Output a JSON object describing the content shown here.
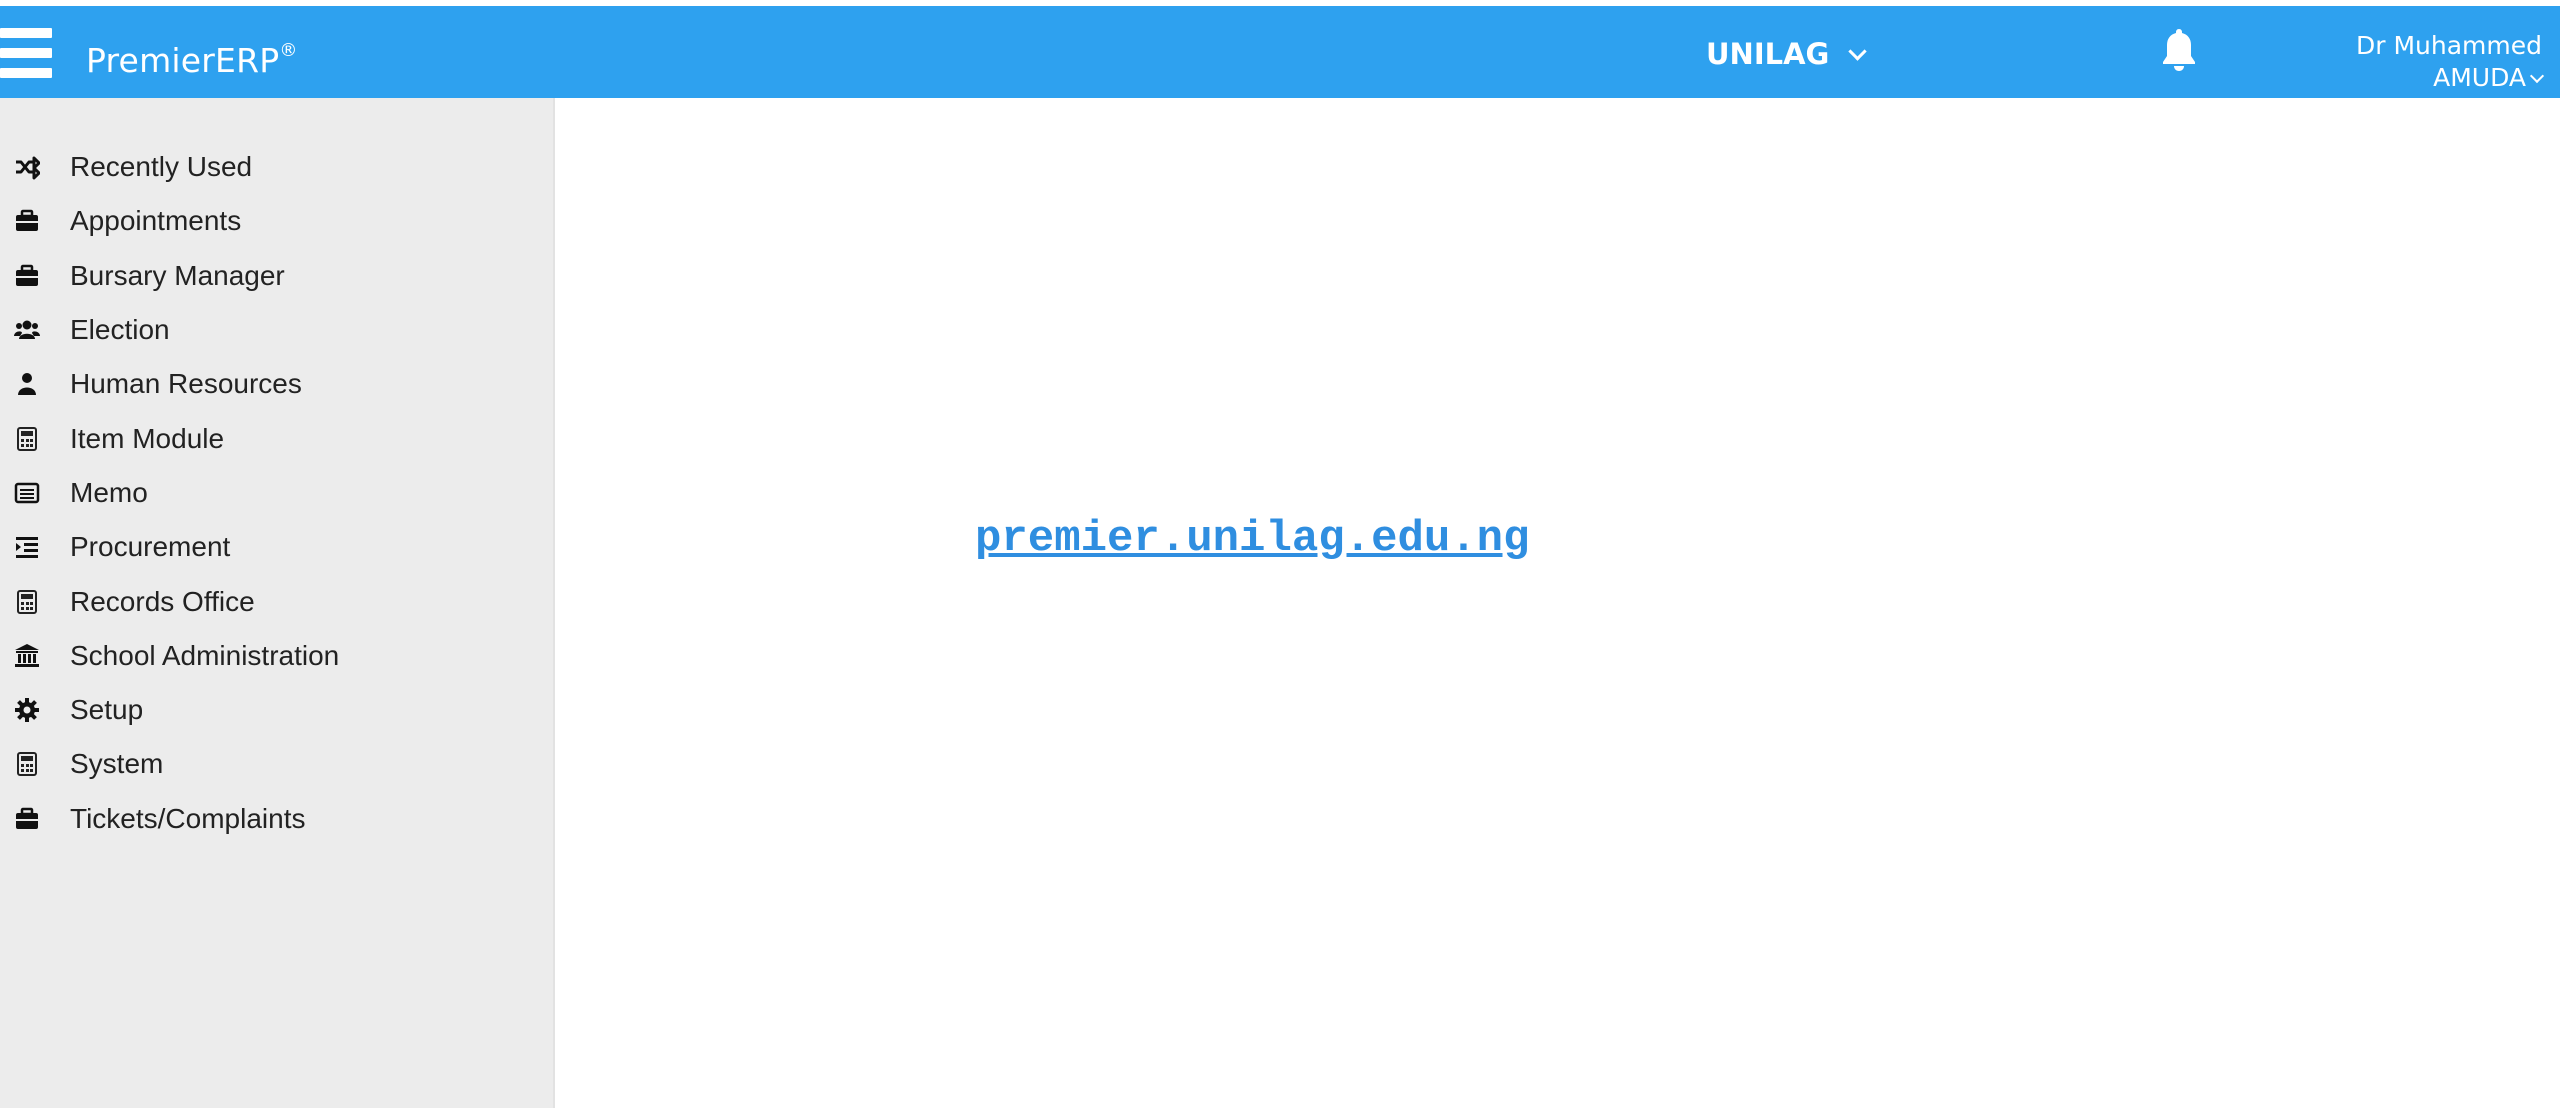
{
  "brand": {
    "name": "PremierERP",
    "mark": "®"
  },
  "header": {
    "organization": "UNILAG",
    "user_line1": "Dr Muhammed",
    "user_line2": "AMUDA"
  },
  "colors": {
    "navbar": "#2ea1ef",
    "sidebar": "#ececec",
    "link": "#2f8ee0"
  },
  "sidebar": {
    "items": [
      {
        "label": "Recently Used",
        "icon": "shuffle-icon"
      },
      {
        "label": "Appointments",
        "icon": "briefcase-icon"
      },
      {
        "label": "Bursary Manager",
        "icon": "briefcase-icon"
      },
      {
        "label": "Election",
        "icon": "users-icon"
      },
      {
        "label": "Human Resources",
        "icon": "user-icon"
      },
      {
        "label": "Item Module",
        "icon": "calculator-icon"
      },
      {
        "label": "Memo",
        "icon": "list-alt-icon"
      },
      {
        "label": "Procurement",
        "icon": "indent-icon"
      },
      {
        "label": "Records Office",
        "icon": "calculator-icon"
      },
      {
        "label": "School Administration",
        "icon": "bank-icon"
      },
      {
        "label": "Setup",
        "icon": "gear-icon"
      },
      {
        "label": "System",
        "icon": "calculator-icon"
      },
      {
        "label": "Tickets/Complaints",
        "icon": "briefcase-icon"
      }
    ]
  },
  "main": {
    "link_text": "premier.unilag.edu.ng"
  }
}
